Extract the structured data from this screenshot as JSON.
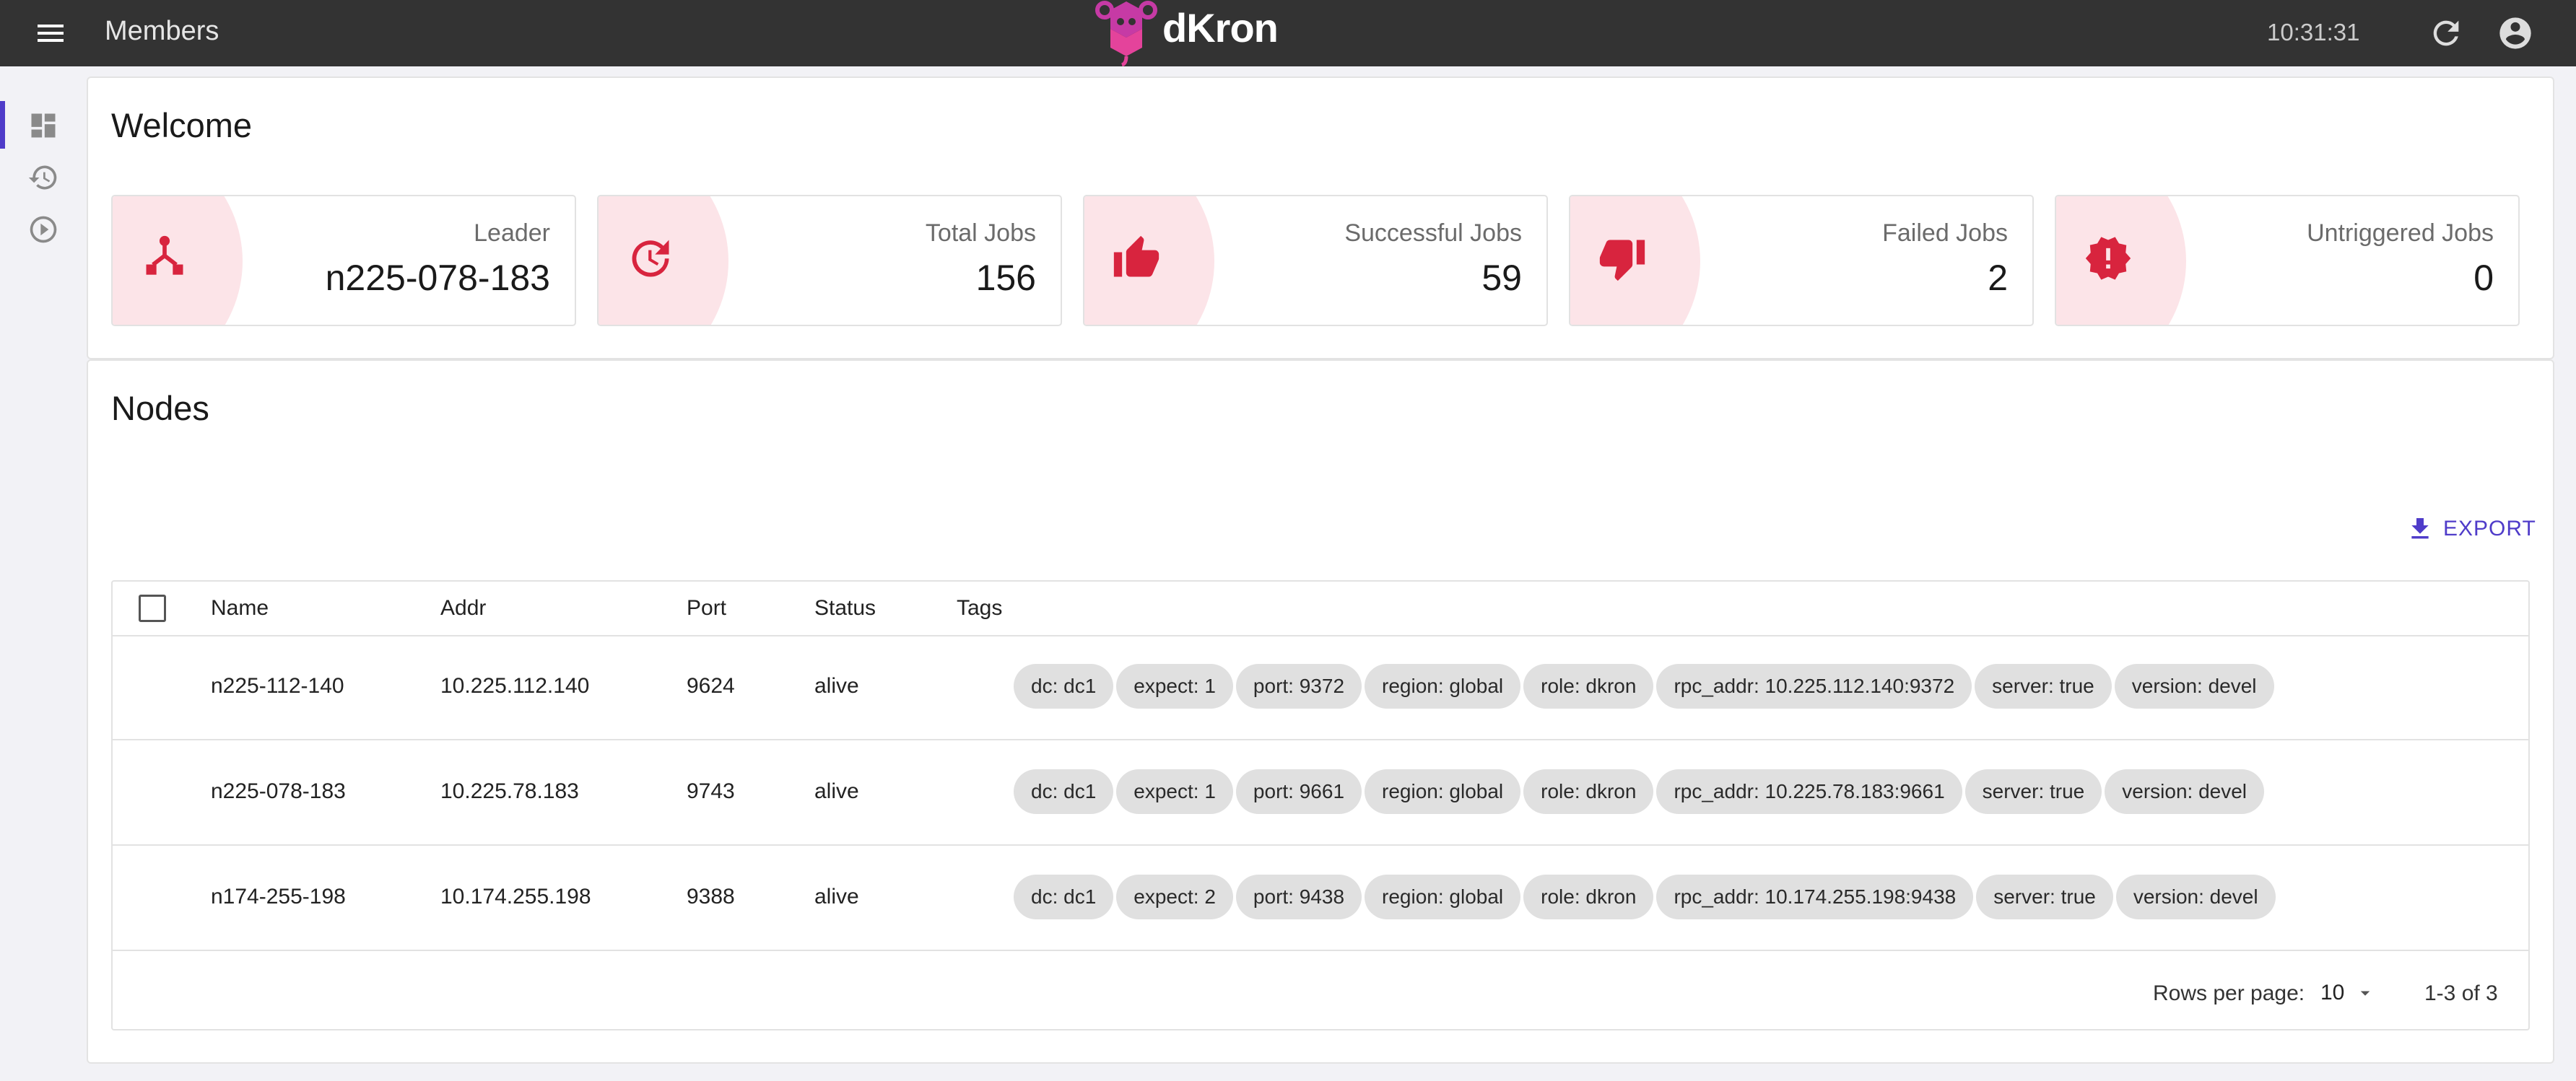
{
  "appbar": {
    "title": "Members",
    "brand": "dKron",
    "clock": "10:31:31",
    "menu_icon": "menu-icon",
    "refresh_icon": "refresh-icon",
    "account_icon": "account-circle-icon"
  },
  "sidebar": {
    "items": [
      {
        "icon": "dashboard-icon",
        "active": true
      },
      {
        "icon": "history-icon",
        "active": false
      },
      {
        "icon": "play-circle-icon",
        "active": false
      }
    ]
  },
  "welcome": {
    "title": "Welcome",
    "stats": [
      {
        "label": "Leader",
        "value": "n225-078-183",
        "icon": "leader-icon"
      },
      {
        "label": "Total Jobs",
        "value": "156",
        "icon": "update-icon"
      },
      {
        "label": "Successful Jobs",
        "value": "59",
        "icon": "thumb-up-icon"
      },
      {
        "label": "Failed Jobs",
        "value": "2",
        "icon": "thumb-down-icon"
      },
      {
        "label": "Untriggered Jobs",
        "value": "0",
        "icon": "new-releases-icon"
      }
    ]
  },
  "nodes": {
    "title": "Nodes",
    "export_label": "EXPORT",
    "columns": [
      "Name",
      "Addr",
      "Port",
      "Status",
      "Tags"
    ],
    "rows": [
      {
        "name": "n225-112-140",
        "addr": "10.225.112.140",
        "port": "9624",
        "status": "alive",
        "tags": [
          "dc: dc1",
          "expect: 1",
          "port: 9372",
          "region: global",
          "role: dkron",
          "rpc_addr: 10.225.112.140:9372",
          "server: true",
          "version: devel"
        ]
      },
      {
        "name": "n225-078-183",
        "addr": "10.225.78.183",
        "port": "9743",
        "status": "alive",
        "tags": [
          "dc: dc1",
          "expect: 1",
          "port: 9661",
          "region: global",
          "role: dkron",
          "rpc_addr: 10.225.78.183:9661",
          "server: true",
          "version: devel"
        ]
      },
      {
        "name": "n174-255-198",
        "addr": "10.174.255.198",
        "port": "9388",
        "status": "alive",
        "tags": [
          "dc: dc1",
          "expect: 2",
          "port: 9438",
          "region: global",
          "role: dkron",
          "rpc_addr: 10.174.255.198:9438",
          "server: true",
          "version: devel"
        ]
      }
    ],
    "pagination": {
      "rows_per_page_label": "Rows per page:",
      "rows_per_page": "10",
      "range": "1-3 of 3"
    }
  },
  "colors": {
    "appbar": "#333333",
    "accent": "#4f3cc9",
    "stat_icon": "#d8243e",
    "stat_blob": "#fce4e8",
    "chip": "#e0e0e0"
  }
}
